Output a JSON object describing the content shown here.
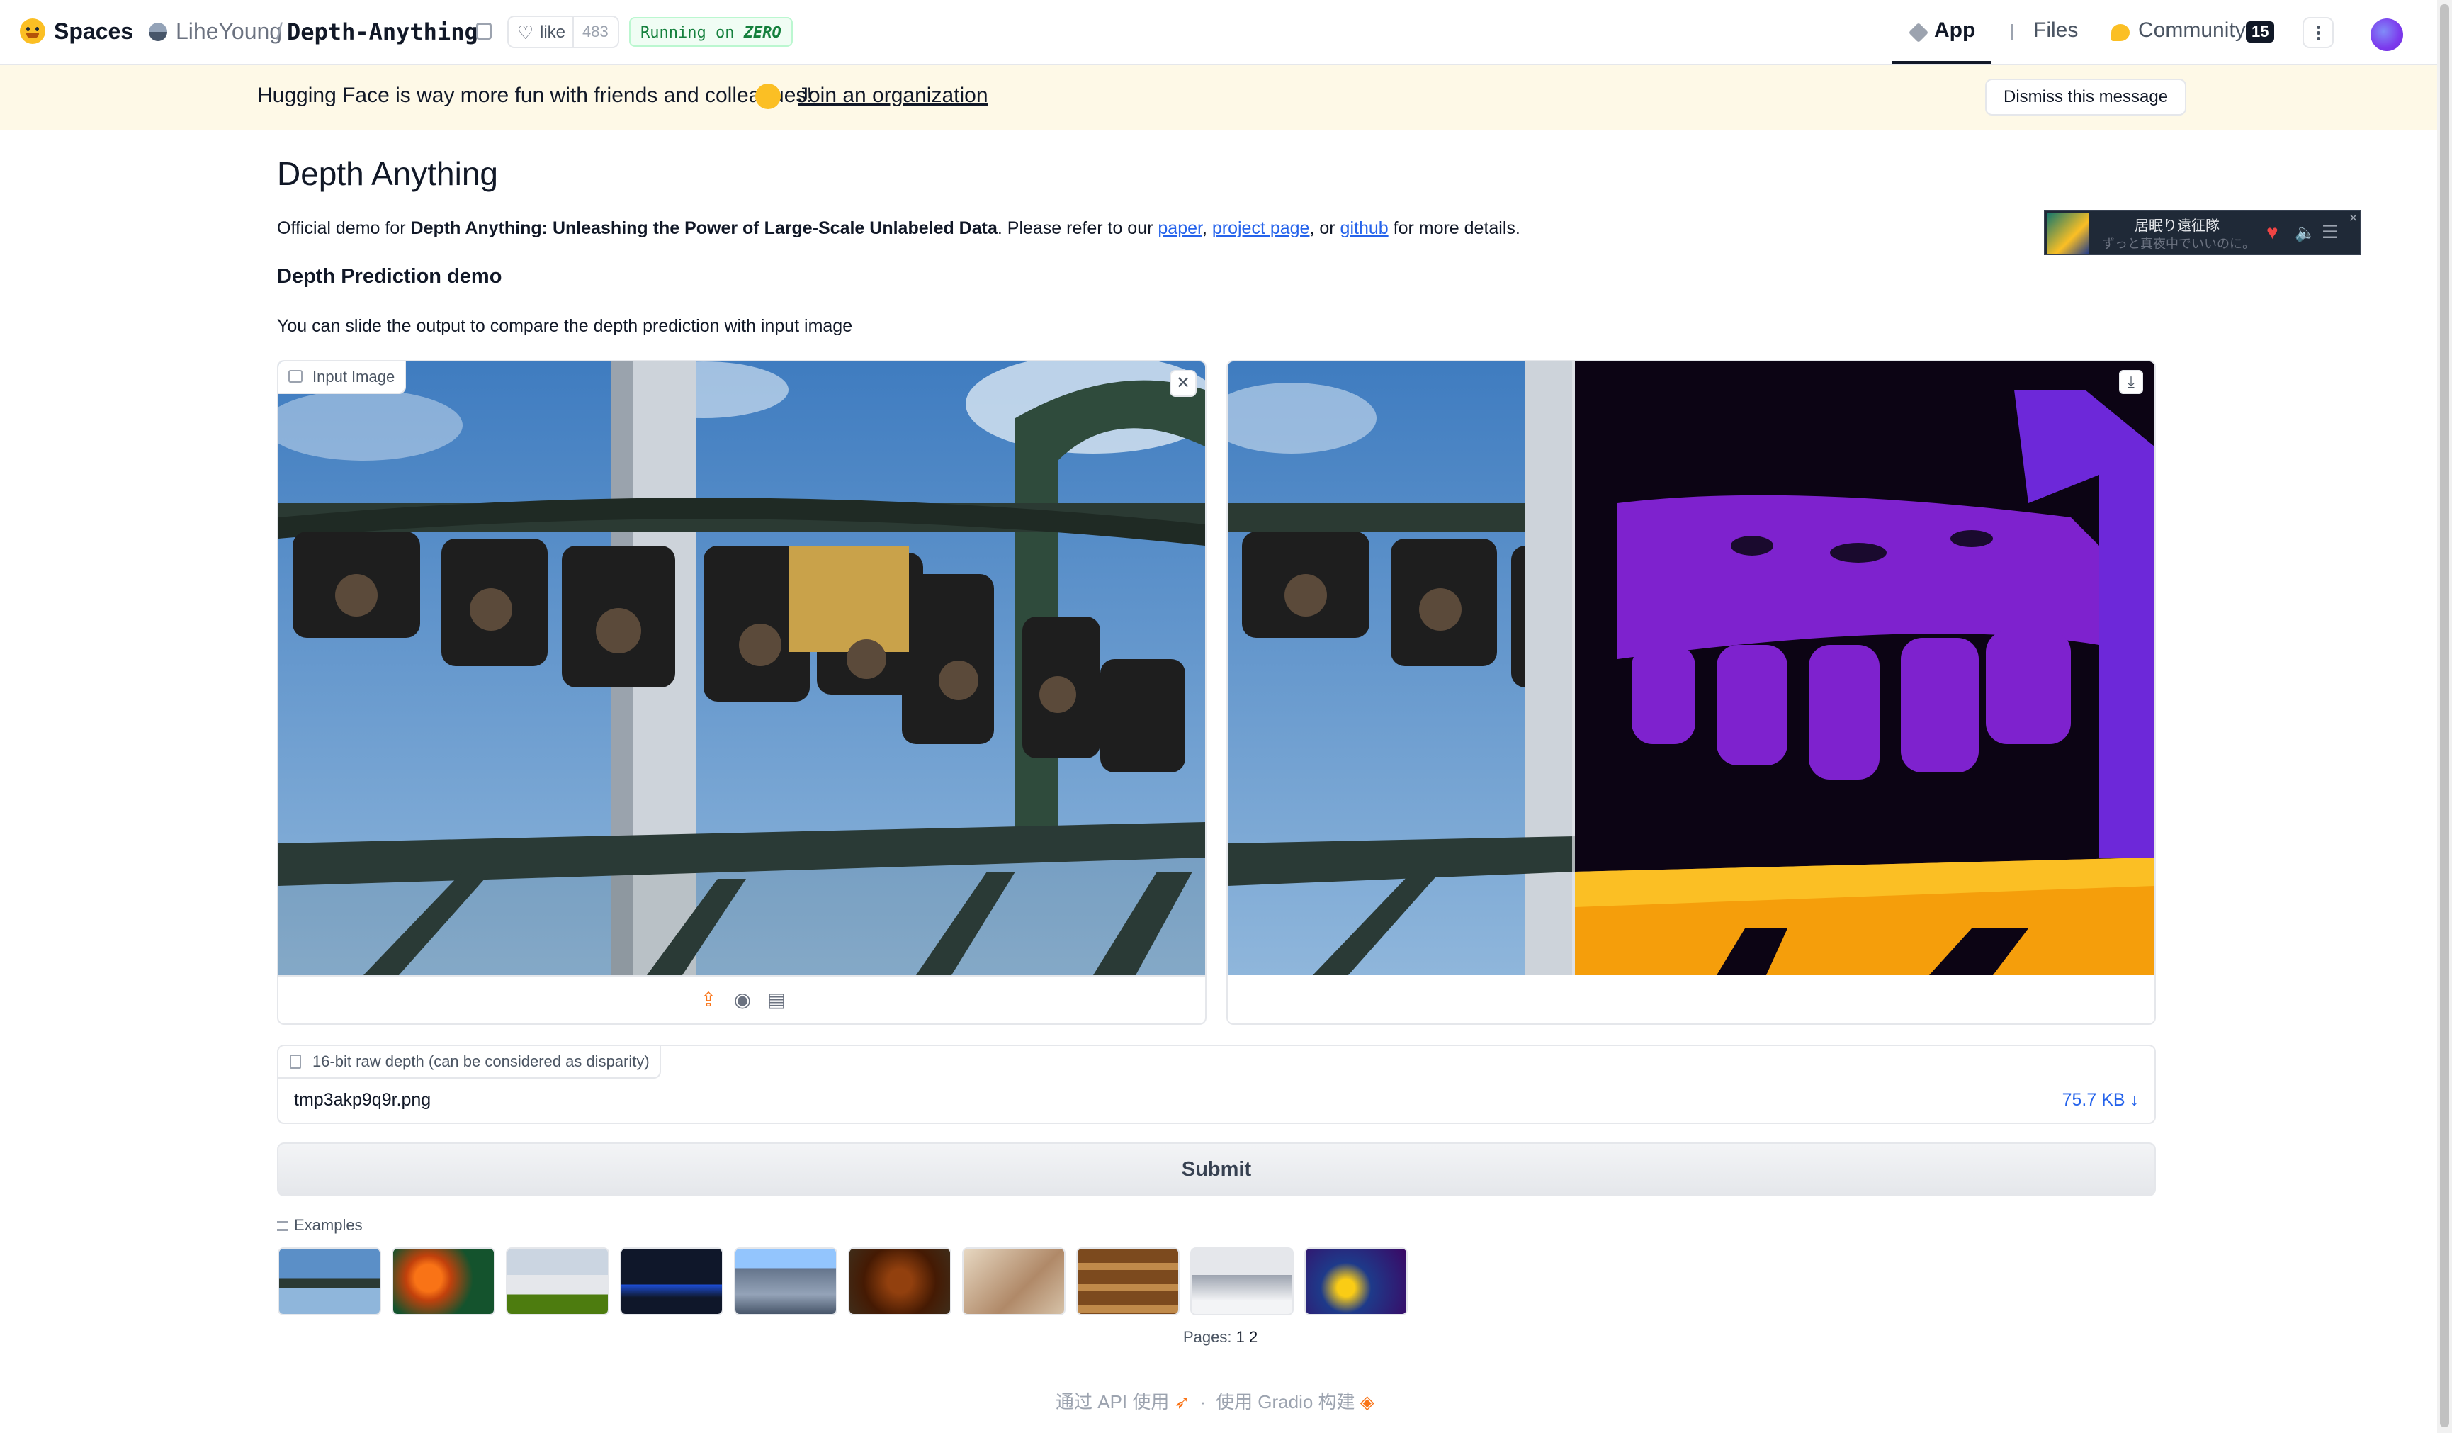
{
  "header": {
    "spaces_label": "Spaces",
    "owner": "LiheYoung",
    "separator": "/",
    "repo": "Depth-Anything",
    "like_label": "like",
    "like_count": "483",
    "status_prefix": "Running on",
    "status_hw": "ZERO",
    "tabs": [
      {
        "label": "App",
        "active": true
      },
      {
        "label": "Files",
        "active": false
      },
      {
        "label": "Community",
        "active": false,
        "badge": "15"
      }
    ]
  },
  "banner": {
    "text": "Hugging Face is way more fun with friends and colleagues!",
    "link": "Join an organization",
    "dismiss": "Dismiss this message"
  },
  "main": {
    "title": "Depth Anything",
    "desc": {
      "prefix": "Official demo for ",
      "bold": "Depth Anything: Unleashing the Power of Large-Scale Unlabeled Data",
      "mid": ". Please refer to our ",
      "link1": "paper",
      "sep1": ", ",
      "link2": "project page",
      "sep2": ", or ",
      "link3": "github",
      "suffix": " for more details."
    },
    "subtitle": "Depth Prediction demo",
    "note": "You can slide the output to compare the depth prediction with input image"
  },
  "player": {
    "title": "居眠り遠征隊",
    "subtitle": "ずっと真夜中でいいのに。"
  },
  "input_panel": {
    "label": "Input Image"
  },
  "file": {
    "label": "16-bit raw depth (can be considered as disparity)",
    "name": "tmp3akp9q9r.png",
    "size": "75.7 KB ↓"
  },
  "submit_label": "Submit",
  "examples": {
    "label": "Examples",
    "items": [
      "roller-coaster",
      "orange-flowers",
      "modern-house",
      "night-city",
      "city-skyline",
      "pinecones",
      "painting",
      "bread-shelves",
      "kitchen",
      "aquarium-fish"
    ],
    "pages_label": "Pages:",
    "pages": [
      "1",
      "2"
    ]
  },
  "footer": {
    "api": "通过 API 使用",
    "dot": "·",
    "gradio": "使用 Gradio 构建"
  },
  "colors": {
    "banner_bg": "#fef9e7",
    "link": "#2563eb",
    "status_green": "#15803d",
    "depth_near": "#f59e0b",
    "depth_mid": "#7e22ce",
    "depth_far": "#0c0414"
  }
}
